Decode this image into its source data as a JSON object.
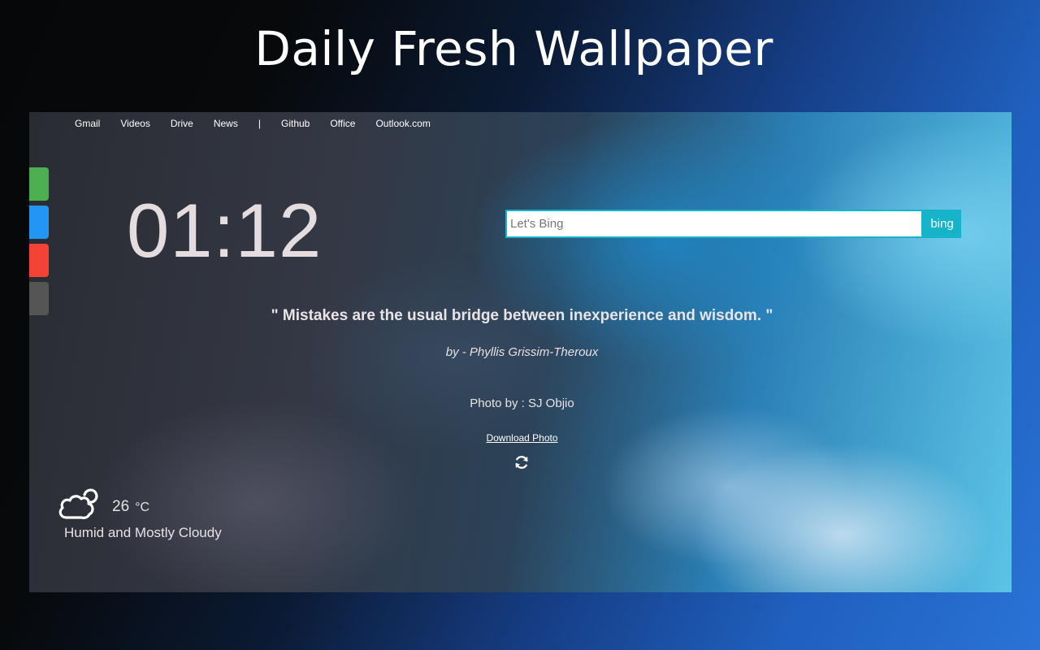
{
  "promo": {
    "title": "Daily Fresh Wallpaper"
  },
  "nav": {
    "links": [
      "Gmail",
      "Videos",
      "Drive",
      "News",
      "|",
      "Github",
      "Office",
      "Outlook.com"
    ]
  },
  "side_tabs": {
    "colors": [
      "#4caf50",
      "#2196f3",
      "#f44336",
      "#555555"
    ]
  },
  "clock": {
    "time": "01:12"
  },
  "search": {
    "placeholder": "Let's Bing",
    "value": "",
    "button_label": "bing",
    "accent_color": "#17b4c9"
  },
  "quote": {
    "text": "\" Mistakes are the usual bridge between inexperience and wisdom. \"",
    "author": "by - Phyllis Grissim-Theroux"
  },
  "photo": {
    "credit": "Photo by : SJ Objio",
    "download_label": "Download Photo",
    "refresh_icon": "refresh-icon"
  },
  "weather": {
    "icon": "cloud-icon",
    "temperature": "26",
    "unit": "°C",
    "condition": "Humid and Mostly Cloudy"
  }
}
